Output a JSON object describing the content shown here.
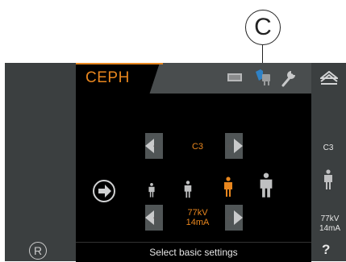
{
  "callout": {
    "letter": "C"
  },
  "tabs": {
    "active_label": "CEPH"
  },
  "toolbar_icons": [
    "cassette-icon",
    "patient-positioning-icon",
    "wrench-icon"
  ],
  "right_panel": {
    "program_value": "C3",
    "kv": "77kV",
    "ma": "14mA",
    "help_label": "?",
    "eject_icon": "eject-icon"
  },
  "settings": {
    "program": "C3",
    "kv": "77kV",
    "ma": "14mA",
    "selected_patient_size": 3,
    "patient_sizes": [
      "child-small",
      "child",
      "adult-medium",
      "adult-large"
    ]
  },
  "status": {
    "message": "Select basic settings"
  },
  "bottom_left": {
    "label": "R"
  },
  "colors": {
    "accent": "#e8861e",
    "panel": "#3b3f40",
    "tabbar": "#494d4e",
    "screen": "#000000"
  }
}
